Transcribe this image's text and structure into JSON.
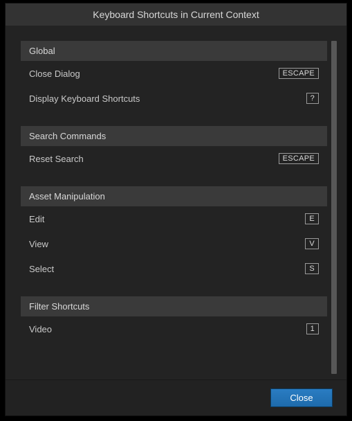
{
  "dialog": {
    "title": "Keyboard Shortcuts in Current Context",
    "close_label": "Close"
  },
  "sections": {
    "global": {
      "title": "Global",
      "items": {
        "close_dialog": {
          "label": "Close Dialog",
          "key": "ESCAPE"
        },
        "display_shortcuts": {
          "label": "Display Keyboard Shortcuts",
          "key": "?"
        }
      }
    },
    "search_commands": {
      "title": "Search Commands",
      "items": {
        "reset_search": {
          "label": "Reset Search",
          "key": "ESCAPE"
        }
      }
    },
    "asset_manipulation": {
      "title": "Asset Manipulation",
      "items": {
        "edit": {
          "label": "Edit",
          "key": "E"
        },
        "view": {
          "label": "View",
          "key": "V"
        },
        "select": {
          "label": "Select",
          "key": "S"
        }
      }
    },
    "filter_shortcuts": {
      "title": "Filter Shortcuts",
      "items": {
        "video": {
          "label": "Video",
          "key": "1"
        }
      }
    }
  }
}
